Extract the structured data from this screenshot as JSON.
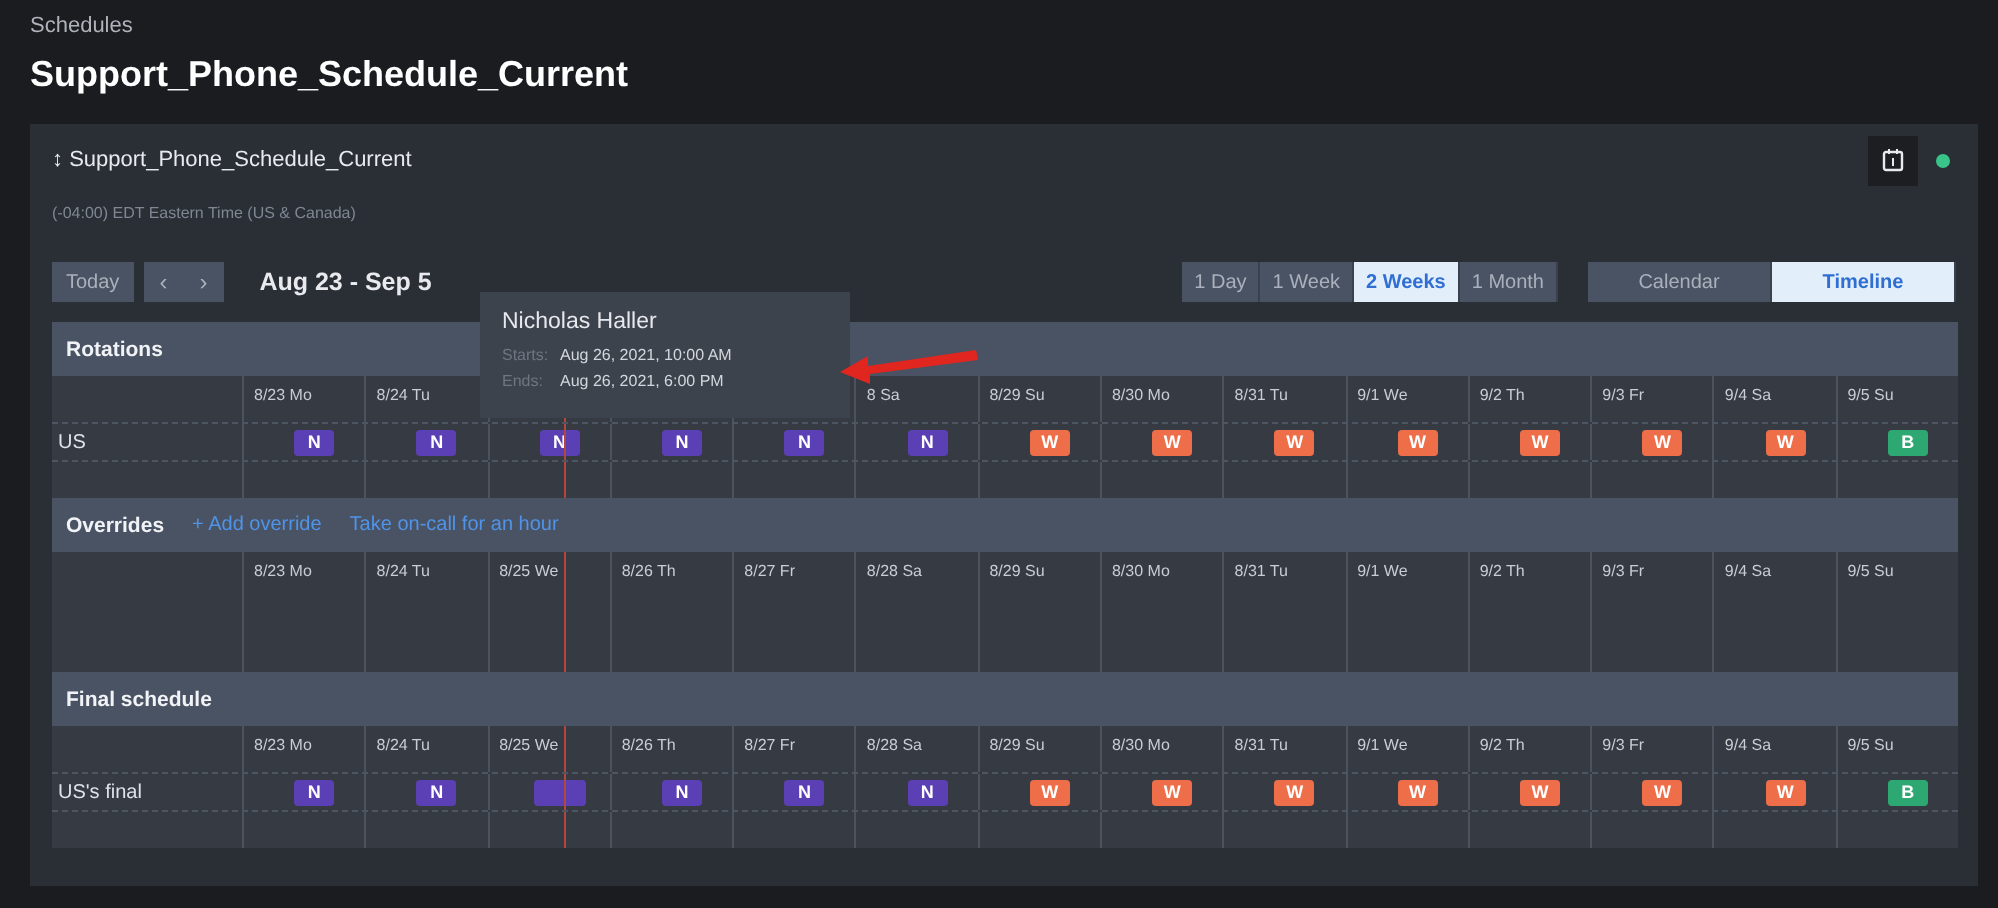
{
  "breadcrumb": "Schedules",
  "title": "Support_Phone_Schedule_Current",
  "card": {
    "sort_glyph": "↕",
    "name": "Support_Phone_Schedule_Current",
    "timezone": "(-04:00) EDT Eastern Time (US & Canada)"
  },
  "toolbar": {
    "today": "Today",
    "prev": "‹",
    "next": "›",
    "range": "Aug 23 - Sep 5",
    "spans": [
      {
        "label": "1 Day",
        "selected": false
      },
      {
        "label": "1 Week",
        "selected": false
      },
      {
        "label": "2 Weeks",
        "selected": true
      },
      {
        "label": "1 Month",
        "selected": false
      }
    ],
    "views": [
      {
        "label": "Calendar",
        "selected": false
      },
      {
        "label": "Timeline",
        "selected": true
      }
    ]
  },
  "sections": [
    {
      "title": "Rotations",
      "days": [
        {
          "label": "8/23 Mo",
          "today": false
        },
        {
          "label": "8/24 Tu",
          "today": false
        },
        {
          "today": true
        },
        {
          "today": false
        },
        {
          "today": false
        },
        {
          "label": "8 Sa",
          "today": false
        },
        {
          "label": "8/29 Su",
          "today": false
        },
        {
          "label": "8/30 Mo",
          "today": false
        },
        {
          "label": "8/31 Tu",
          "today": false
        },
        {
          "label": "9/1 We",
          "today": false
        },
        {
          "label": "9/2 Th",
          "today": false
        },
        {
          "label": "9/3 Fr",
          "today": false
        },
        {
          "label": "9/4 Sa",
          "today": false
        },
        {
          "label": "9/5 Su",
          "today": false
        }
      ],
      "rows": [
        {
          "label": "US",
          "shifts": [
            {
              "label": "N",
              "color": "#5b3fb5"
            },
            {
              "label": "N",
              "color": "#5b3fb5"
            },
            {
              "label": "N",
              "color": "#5b3fb5"
            },
            {
              "label": "N",
              "color": "#5b3fb5"
            },
            {
              "label": "N",
              "color": "#5b3fb5"
            },
            {
              "label": "N",
              "color": "#5b3fb5"
            },
            {
              "label": "W",
              "color": "#ef6e4a"
            },
            {
              "label": "W",
              "color": "#ef6e4a"
            },
            {
              "label": "W",
              "color": "#ef6e4a"
            },
            {
              "label": "W",
              "color": "#ef6e4a"
            },
            {
              "label": "W",
              "color": "#ef6e4a"
            },
            {
              "label": "W",
              "color": "#ef6e4a"
            },
            {
              "label": "W",
              "color": "#ef6e4a"
            },
            {
              "label": "B",
              "color": "#2ea872"
            }
          ]
        }
      ]
    },
    {
      "title": "Overrides",
      "actions": [
        "+ Add override",
        "Take on-call for an hour"
      ],
      "days": [
        {
          "label": "8/23 Mo",
          "today": false
        },
        {
          "label": "8/24 Tu",
          "today": false
        },
        {
          "label": "8/25 We",
          "today": true
        },
        {
          "label": "8/26 Th",
          "today": false
        },
        {
          "label": "8/27 Fr",
          "today": false
        },
        {
          "label": "8/28 Sa",
          "today": false
        },
        {
          "label": "8/29 Su",
          "today": false
        },
        {
          "label": "8/30 Mo",
          "today": false
        },
        {
          "label": "8/31 Tu",
          "today": false
        },
        {
          "label": "9/1 We",
          "today": false
        },
        {
          "label": "9/2 Th",
          "today": false
        },
        {
          "label": "9/3 Fr",
          "today": false
        },
        {
          "label": "9/4 Sa",
          "today": false
        },
        {
          "label": "9/5 Su",
          "today": false
        }
      ]
    },
    {
      "title": "Final schedule",
      "days": [
        {
          "label": "8/23 Mo",
          "today": false
        },
        {
          "label": "8/24 Tu",
          "today": false
        },
        {
          "label": "8/25 We",
          "today": true
        },
        {
          "label": "8/26 Th",
          "today": false
        },
        {
          "label": "8/27 Fr",
          "today": false
        },
        {
          "label": "8/28 Sa",
          "today": false
        },
        {
          "label": "8/29 Su",
          "today": false
        },
        {
          "label": "8/30 Mo",
          "today": false
        },
        {
          "label": "8/31 Tu",
          "today": false
        },
        {
          "label": "9/1 We",
          "today": false
        },
        {
          "label": "9/2 Th",
          "today": false
        },
        {
          "label": "9/3 Fr",
          "today": false
        },
        {
          "label": "9/4 Sa",
          "today": false
        },
        {
          "label": "9/5 Su",
          "today": false
        }
      ],
      "rows": [
        {
          "label": "US's final",
          "shifts": [
            {
              "label": "N",
              "color": "#5b3fb5"
            },
            {
              "label": "N",
              "color": "#5b3fb5"
            },
            {
              "color": "#5b3fb5"
            },
            {
              "label": "N",
              "color": "#5b3fb5"
            },
            {
              "label": "N",
              "color": "#5b3fb5"
            },
            {
              "label": "N",
              "color": "#5b3fb5"
            },
            {
              "label": "W",
              "color": "#ef6e4a"
            },
            {
              "label": "W",
              "color": "#ef6e4a"
            },
            {
              "label": "W",
              "color": "#ef6e4a"
            },
            {
              "label": "W",
              "color": "#ef6e4a"
            },
            {
              "label": "W",
              "color": "#ef6e4a"
            },
            {
              "label": "W",
              "color": "#ef6e4a"
            },
            {
              "label": "W",
              "color": "#ef6e4a"
            },
            {
              "label": "B",
              "color": "#2ea872"
            }
          ]
        }
      ]
    }
  ],
  "tooltip": {
    "name": "Nicholas Haller",
    "starts_label": "Starts:",
    "starts": "Aug 26, 2021, 10:00 AM",
    "ends_label": "Ends:",
    "ends": "Aug 26, 2021, 6:00 PM"
  }
}
